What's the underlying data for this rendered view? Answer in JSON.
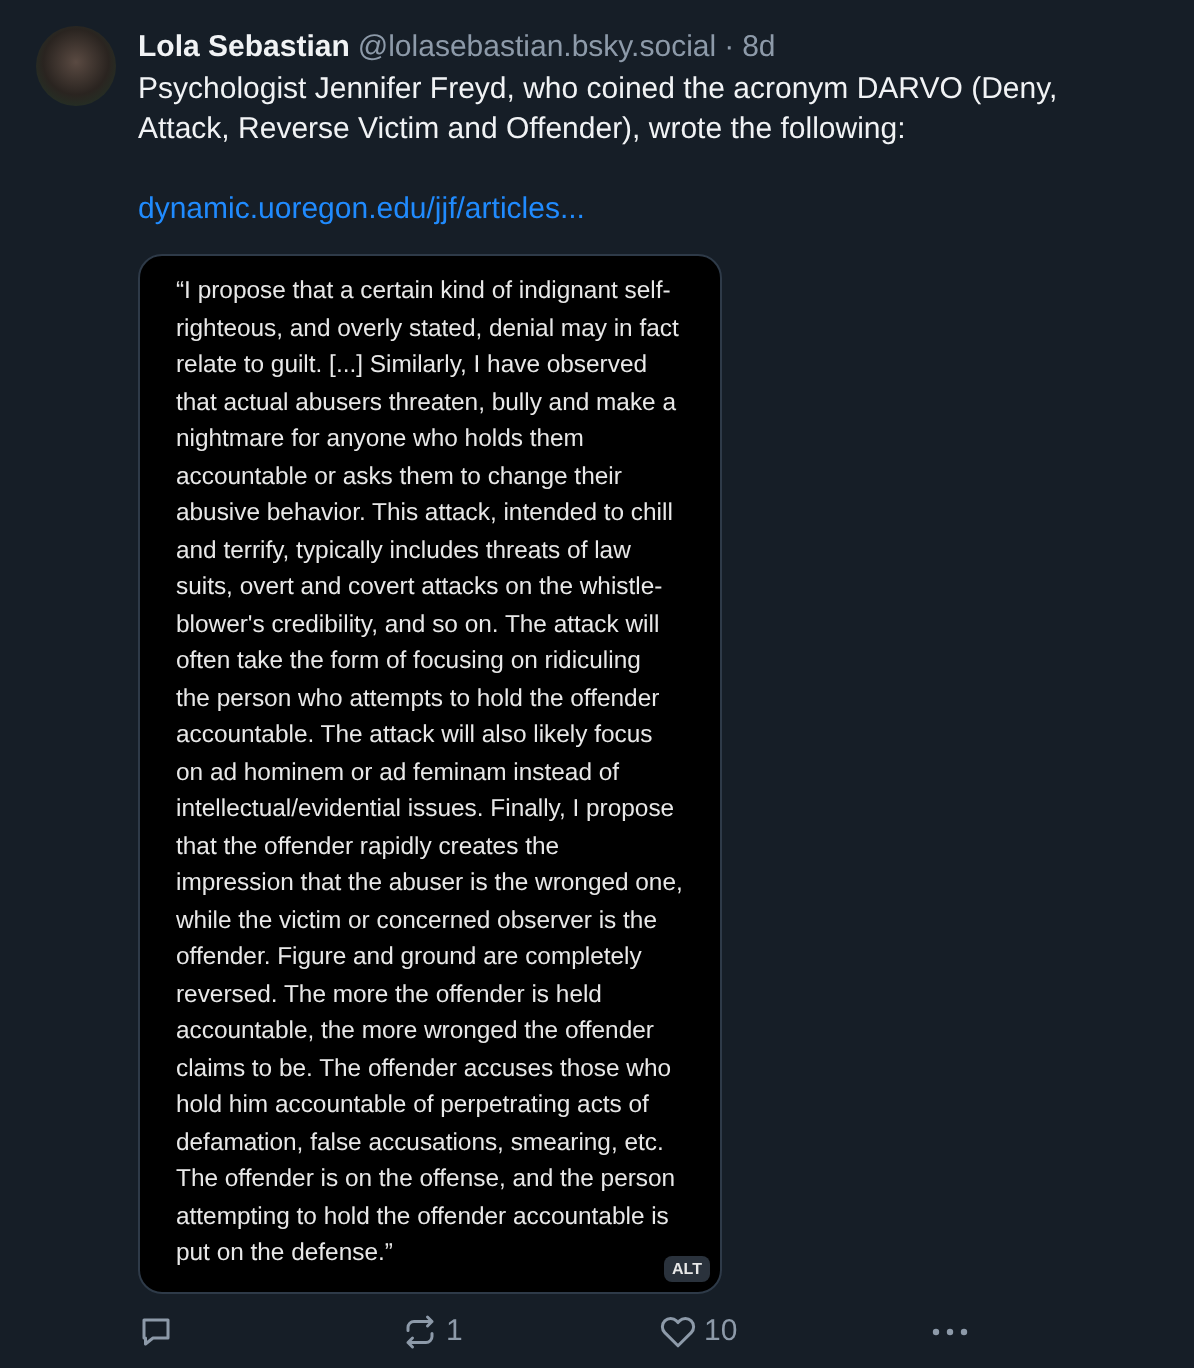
{
  "post": {
    "author": "Lola Sebastian",
    "handle": "@lolasebastian.bsky.social",
    "separator": "·",
    "age": "8d",
    "text": "Psychologist Jennifer Freyd, who coined the acronym DARVO (Deny, Attack, Reverse Victim and Offender), wrote the following:",
    "link": "dynamic.uoregon.edu/jjf/articles...",
    "image": {
      "lines": [
        "“I propose that a certain kind of indignant self-",
        "righteous, and overly stated, denial may in fact",
        "relate to guilt. [...] Similarly, I have observed",
        "that actual abusers threaten, bully and make a",
        "nightmare for anyone who holds them",
        "accountable or asks them to change their",
        "abusive behavior. This attack, intended to chill",
        "and terrify, typically includes threats of law",
        "suits, overt and covert attacks on the whistle-",
        "blower's credibility, and so on. The attack will",
        "often take the form of focusing on ridiculing",
        "the person who attempts to hold the offender",
        "accountable. The attack will also likely focus",
        "on ad hominem or ad feminam instead of",
        "intellectual/evidential issues. Finally, I propose",
        "that the offender rapidly creates the",
        "impression that the abuser is the wronged one,",
        "while the victim or concerned observer is the",
        "offender. Figure and ground are completely",
        "reversed. The more the offender is held",
        "accountable, the more wronged the offender",
        "claims to be. The offender accuses those who",
        "hold him accountable of perpetrating acts of",
        "defamation, false accusations, smearing, etc.",
        "The offender is on the offense, and the person",
        "attempting to hold the offender accountable is",
        "put on the defense.”"
      ],
      "alt_badge": "ALT"
    },
    "actions": [
      {
        "kind": "reply"
      },
      {
        "kind": "repost",
        "count": "1"
      },
      {
        "kind": "like",
        "count": "10"
      },
      {
        "kind": "more"
      }
    ]
  }
}
